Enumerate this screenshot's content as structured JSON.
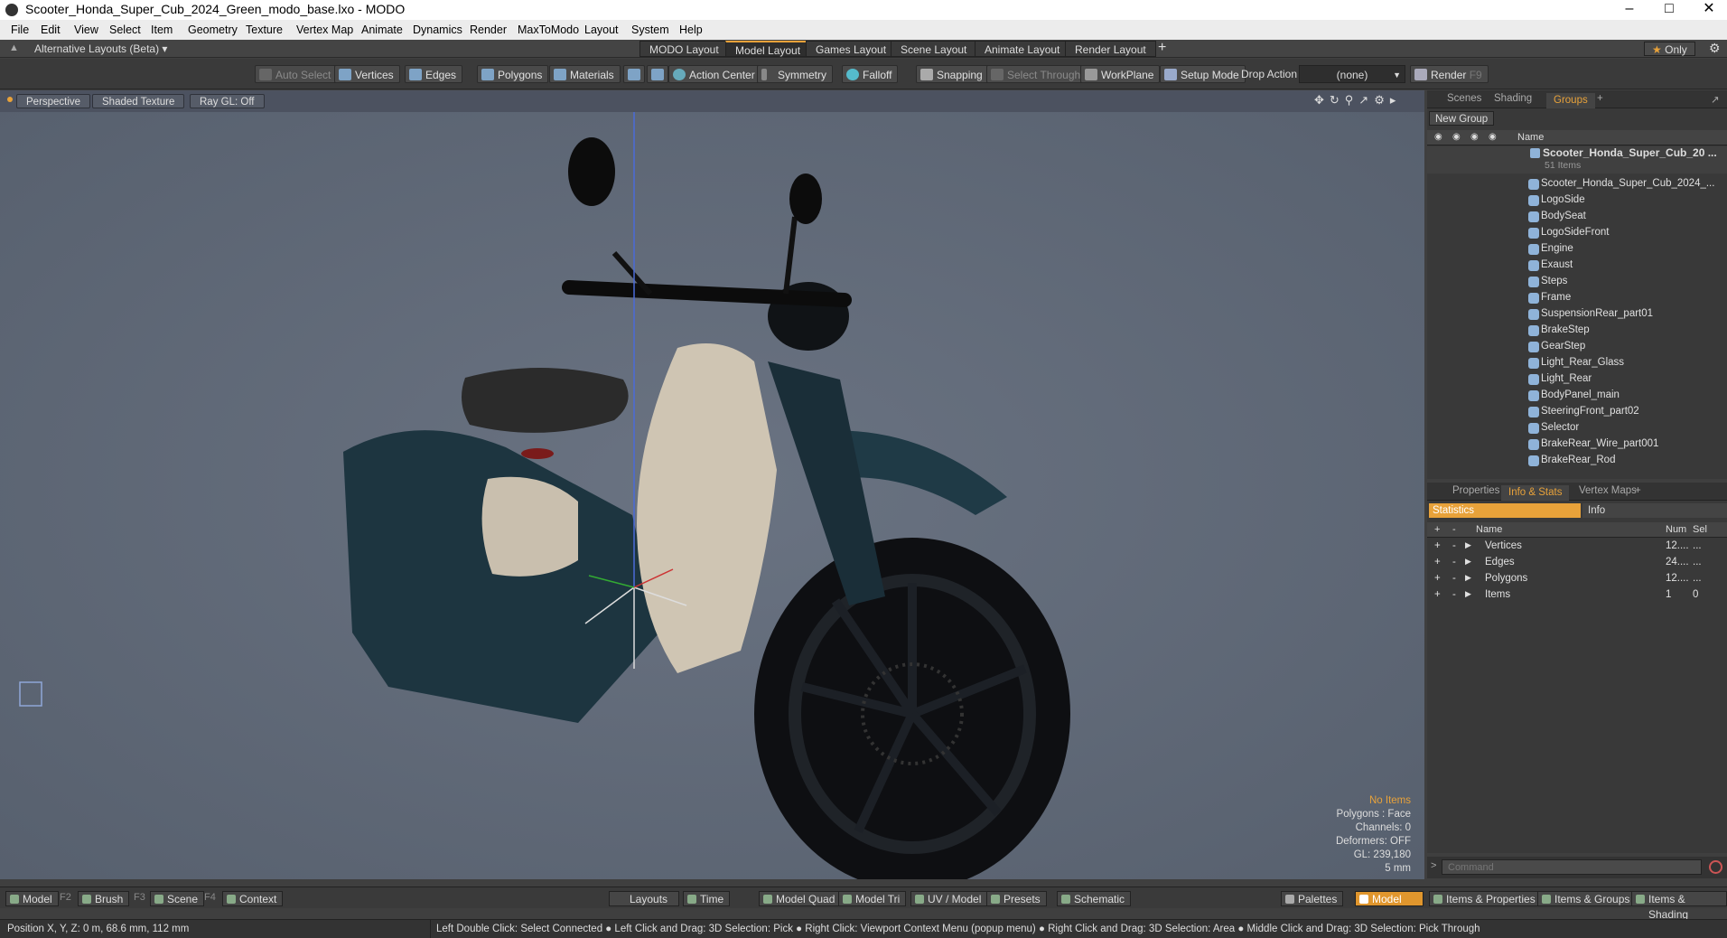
{
  "window": {
    "title": "Scooter_Honda_Super_Cub_2024_Green_modo_base.lxo - MODO",
    "min": "–",
    "max": "□",
    "close": "✕"
  },
  "menu": [
    "File",
    "Edit",
    "View",
    "Select",
    "Item",
    "Geometry",
    "Texture",
    "Vertex Map",
    "Animate",
    "Dynamics",
    "Render",
    "MaxToModo",
    "Layout",
    "System",
    "Help"
  ],
  "layouts": {
    "switcher": "Alternative Layouts (Beta)",
    "tabs": [
      "MODO Layout",
      "Model Layout",
      "Games Layout",
      "Scene Layout",
      "Animate Layout",
      "Render Layout"
    ],
    "active": 1,
    "add": "+",
    "only": "Only"
  },
  "toolbar": {
    "auto_select": "Auto Select",
    "vertices": "Vertices",
    "edges": "Edges",
    "polygons": "Polygons",
    "materials": "Materials",
    "action_center": "Action Center",
    "symmetry": "Symmetry",
    "falloff": "Falloff",
    "snapping": "Snapping",
    "select_through": "Select Through",
    "workplane": "WorkPlane",
    "setup_mode": "Setup Mode",
    "drop_action": "Drop Action",
    "drop_value": "(none)",
    "render": "Render",
    "render_key": "F9"
  },
  "viewport": {
    "view": "Perspective",
    "shading": "Shaded Texture",
    "raygl": "Ray GL: Off",
    "info": {
      "no_items": "No Items",
      "polygons": "Polygons : Face",
      "channels": "Channels: 0",
      "deformers": "Deformers: OFF",
      "gl": "GL: 239,180",
      "scale": "5 mm"
    }
  },
  "scene_panel": {
    "tabs": [
      "Scenes",
      "Shading",
      "Groups"
    ],
    "active": 2,
    "new_group": "New Group",
    "name_col": "Name",
    "group": {
      "name": "Scooter_Honda_Super_Cub_20 ...",
      "count": "51 Items"
    },
    "items": [
      "Scooter_Honda_Super_Cub_2024_...",
      "LogoSide",
      "BodySeat",
      "LogoSideFront",
      "Engine",
      "Exaust",
      "Steps",
      "Frame",
      "SuspensionRear_part01",
      "BrakeStep",
      "GearStep",
      "Light_Rear_Glass",
      "Light_Rear",
      "BodyPanel_main",
      "SteeringFront_part02",
      "Selector",
      "BrakeRear_Wire_part001",
      "BrakeRear_Rod"
    ]
  },
  "props_panel": {
    "tabs": [
      "Properties",
      "Info & Stats",
      "Vertex Maps"
    ],
    "active": 1,
    "subtabs": [
      "Statistics",
      "Info"
    ],
    "cols": [
      "Name",
      "Num",
      "Sel"
    ],
    "rows": [
      {
        "name": "Vertices",
        "num": "12....",
        "sel": "..."
      },
      {
        "name": "Edges",
        "num": "24....",
        "sel": "..."
      },
      {
        "name": "Polygons",
        "num": "12....",
        "sel": "..."
      },
      {
        "name": "Items",
        "num": "1",
        "sel": "0"
      }
    ]
  },
  "command": {
    "placeholder": "Command"
  },
  "bottom": {
    "model": "Model",
    "model_key": "F2",
    "brush": "Brush",
    "brush_key": "F3",
    "scene": "Scene",
    "scene_key": "F4",
    "context": "Context",
    "layouts": "Layouts",
    "time": "Time",
    "model_quad": "Model Quad",
    "model_tri": "Model Tri",
    "uv_model": "UV / Model",
    "presets": "Presets",
    "schematic": "Schematic",
    "palettes": "Palettes",
    "model_mode": "Model",
    "items_props": "Items & Properties",
    "items_groups": "Items & Groups",
    "items_shading": "Items & Shading"
  },
  "status": {
    "position": "Position X, Y, Z:   0 m, 68.6 mm, 112 mm",
    "hints": "Left Double Click: Select Connected ● Left Click and Drag: 3D Selection: Pick ● Right Click: Viewport Context Menu (popup menu) ● Right Click and Drag: 3D Selection: Area ● Middle Click and Drag: 3D Selection: Pick Through"
  },
  "colors": {
    "accent": "#e8a23a",
    "viewport": "#5c6573"
  }
}
